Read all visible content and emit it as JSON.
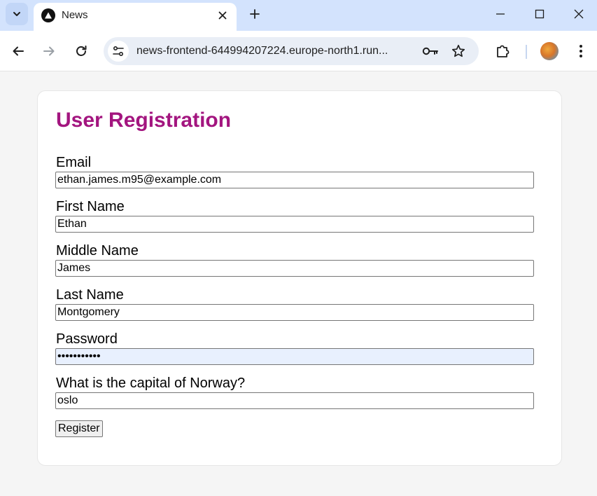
{
  "browser": {
    "tab": {
      "title": "News"
    },
    "address_bar": {
      "url": "news-frontend-644994207224.europe-north1.run..."
    },
    "icons": {
      "tab_search": "chevron-down-icon",
      "favicon": "triangle-logo-icon",
      "tab_close": "close-icon",
      "new_tab": "plus-icon",
      "minimize": "minimize-icon",
      "maximize": "maximize-icon",
      "close_window": "close-icon",
      "back": "arrow-left-icon",
      "forward": "arrow-right-icon",
      "reload": "reload-icon",
      "site_info": "tune-icon",
      "password_key": "key-icon",
      "bookmark": "star-icon",
      "extensions": "puzzle-icon",
      "menu": "more-vert-icon"
    }
  },
  "page": {
    "title": "User Registration",
    "fields": [
      {
        "label": "Email",
        "value": "ethan.james.m95@example.com",
        "type": "text"
      },
      {
        "label": "First Name",
        "value": "Ethan",
        "type": "text"
      },
      {
        "label": "Middle Name",
        "value": "James",
        "type": "text"
      },
      {
        "label": "Last Name",
        "value": "Montgomery",
        "type": "text"
      },
      {
        "label": "Password",
        "value": "•••••••••••",
        "type": "password"
      },
      {
        "label": "What is the capital of Norway?",
        "value": "oslo",
        "type": "text"
      }
    ],
    "submit_label": "Register"
  },
  "colors": {
    "title": "#a3157f",
    "tab_strip": "#d3e3fd",
    "omnibox": "#e9eef6",
    "page_background": "#f5f5f5",
    "autofill_background": "#e8f0fe"
  }
}
